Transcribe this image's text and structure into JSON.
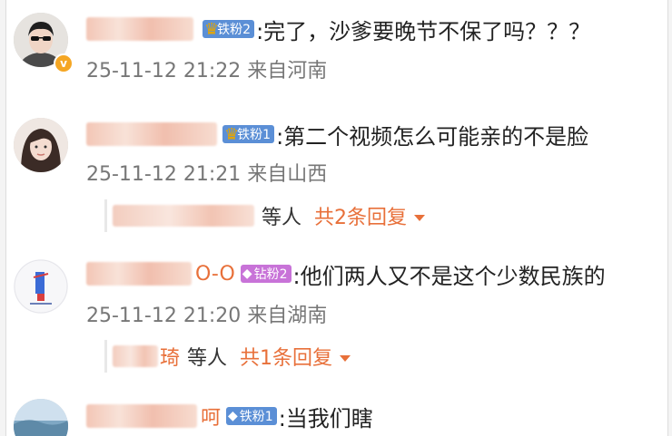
{
  "comments": [
    {
      "name_suffix": "",
      "badge": "铁粉2",
      "badge_type": "iron",
      "badge_icon": "crown-icon",
      "text": ":完了，沙爹要晚节不保了吗？？？",
      "meta": "25-11-12 21:22 来自河南",
      "verified": "v"
    },
    {
      "name_suffix": "",
      "badge": "铁粉1",
      "badge_type": "iron",
      "badge_icon": "crown-icon",
      "text": ":第二个视频怎么可能亲的不是脸",
      "meta": "25-11-12 21:21 来自山西",
      "reply": {
        "tail": "",
        "etc": "等人",
        "more": "共2条回复"
      }
    },
    {
      "name_suffix": "O-O",
      "badge": "钻粉2",
      "badge_type": "drill",
      "badge_icon": "diamond-icon",
      "text": ":他们两人又不是这个少数民族的",
      "meta": "25-11-12 21:20 来自湖南",
      "reply": {
        "tail": "琦",
        "etc": "等人",
        "more": "共1条回复"
      }
    },
    {
      "name_suffix": "呵",
      "badge": "铁粉1",
      "badge_type": "iron",
      "badge_icon": "diamond-icon",
      "text": ":当我们瞎"
    }
  ],
  "colors": {
    "accent": "#e8703a",
    "iron_badge": "#5b8fd6",
    "drill_badge": "#c873d8",
    "meta_text": "#777777"
  }
}
